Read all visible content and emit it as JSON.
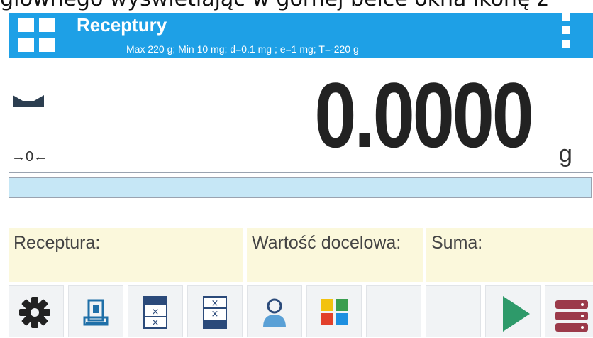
{
  "caption": "głównego wyświetlając w górnej belce okna ikonę z",
  "header": {
    "menu_icon": "grid-menu-icon",
    "title": "Receptury",
    "specs": "Max 220 g; Min 10 mg; d=0.1 mg ; e=1 mg; T=-220 g",
    "more_icon": "kebab-menu-icon"
  },
  "display": {
    "stable_icon": "stability-marker-icon",
    "zero_indicator": "→0←",
    "value": "0.0000",
    "unit": "g"
  },
  "progress": {
    "fraction": 0
  },
  "info": {
    "recipe_label": "Receptura:",
    "target_label": "Wartość docelowa:",
    "sum_label": "Suma:"
  },
  "toolbar": {
    "buttons": [
      {
        "icon": "gear-icon"
      },
      {
        "icon": "scale-tare-icon"
      },
      {
        "icon": "remove-component-icon"
      },
      {
        "icon": "clear-component-icon"
      },
      {
        "icon": "user-icon"
      },
      {
        "icon": "product-database-icon"
      },
      {
        "icon": "empty-slot"
      },
      {
        "icon": "empty-slot"
      },
      {
        "icon": "play-icon"
      },
      {
        "icon": "database-server-icon"
      }
    ]
  },
  "colors": {
    "accent": "#1ea0e6",
    "info_background": "#fbf8dc",
    "progress_track": "#c6e7f6",
    "play_green": "#2e9a6a",
    "db_red": "#9b3a4a"
  }
}
